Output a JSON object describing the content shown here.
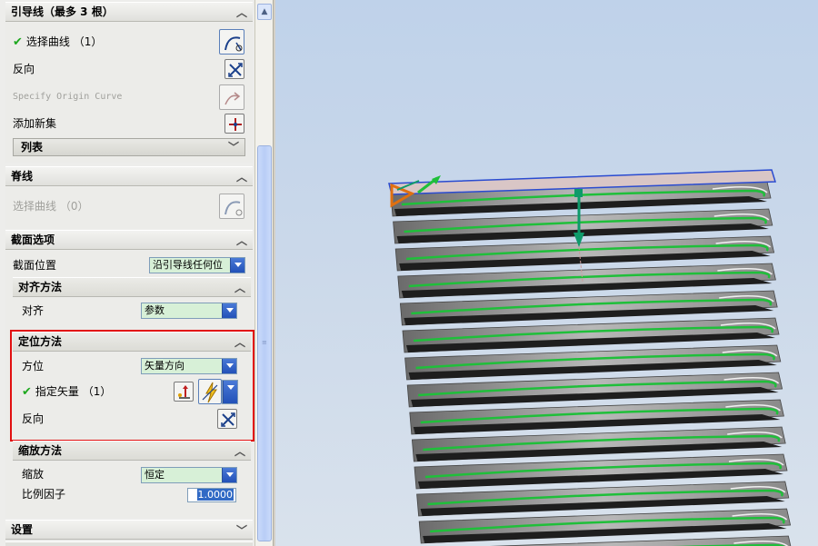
{
  "panel": {
    "guide": {
      "title": "引导线（最多 3 根）",
      "select_curve": "选择曲线 （1）",
      "reverse": "反向",
      "specify_origin_curve": "Specify Origin Curve",
      "add_new_set": "添加新集",
      "list": "列表"
    },
    "spine": {
      "title": "脊线",
      "select_curve": "选择曲线 （0）"
    },
    "section_options": {
      "title": "截面选项",
      "position_label": "截面位置",
      "position_value": "沿引导线任何位",
      "alignment": {
        "title": "对齐方法",
        "label": "对齐",
        "value": "参数"
      },
      "orientation": {
        "title": "定位方法",
        "label": "方位",
        "value": "矢量方向",
        "specify_vector": "指定矢量 （1）",
        "reverse": "反向"
      },
      "scaling": {
        "title": "缩放方法",
        "label": "缩放",
        "value": "恒定",
        "factor_label": "比例因子",
        "factor_value": "1.0000"
      }
    },
    "settings": {
      "title": "设置"
    }
  },
  "colors": {
    "highlight_box": "#e11010",
    "checkmark": "#1ea81e",
    "helix_green": "#1fbf3a",
    "vector_green": "#0e9a6a"
  }
}
